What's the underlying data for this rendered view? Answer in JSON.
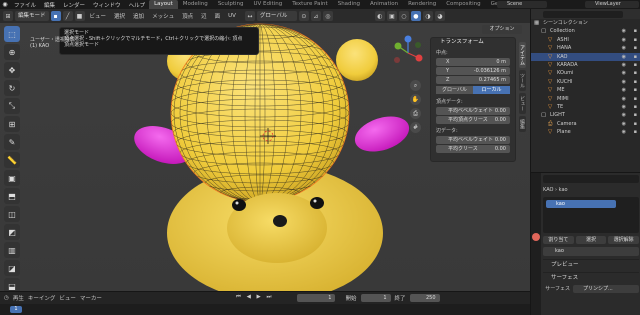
{
  "topbar": {
    "menus": [
      "ファイル",
      "編集",
      "レンダー",
      "ウィンドウ",
      "ヘルプ"
    ],
    "workspaces": [
      "Layout",
      "Modeling",
      "Sculpting",
      "UV Editing",
      "Texture Paint",
      "Shading",
      "Animation",
      "Rendering",
      "Compositing",
      "Geom"
    ],
    "active_workspace": "Layout",
    "scene": "Scene",
    "view_layer": "ViewLayer"
  },
  "viewport_header": {
    "mode": "編集モード",
    "menus": [
      "ビュー",
      "選択",
      "追加",
      "メッシュ",
      "頂点",
      "辺",
      "面",
      "UV"
    ],
    "transform_orientation": "グローバル",
    "options_label": "オプション"
  },
  "tooltip": {
    "line1": "選択モード",
    "line2": "頂点選択 - Shift＋クリックでマルチモード，Ctrl＋クリックで選択の縮小: 頂点",
    "line3": "頂点選択モード"
  },
  "viewport": {
    "view_name": "ユーザー・透視投影",
    "object_info": "(1) KAO"
  },
  "npanel": {
    "title": "トランスフォーム",
    "median_label": "中点:",
    "fields": [
      {
        "axis": "X",
        "value": "0 m"
      },
      {
        "axis": "Y",
        "value": "-0.036126 m"
      },
      {
        "axis": "Z",
        "value": "0.27465 m"
      }
    ],
    "toggle": [
      "グローバル",
      "ローカル"
    ],
    "active_toggle": "ローカル",
    "vertex_data_label": "頂点データ:",
    "vertex_rows": [
      {
        "label": "平均ベベルウェイト",
        "value": "0.00"
      },
      {
        "label": "平均頂点クリース",
        "value": "0.00"
      }
    ],
    "edge_data_label": "辺データ:",
    "edge_rows": [
      {
        "label": "平均ベベルウェイト",
        "value": "0.00"
      },
      {
        "label": "平均クリース",
        "value": "0.00"
      }
    ],
    "side_tabs": [
      "アイテム",
      "ツール",
      "ビュー",
      "編集"
    ]
  },
  "outliner": {
    "rows": [
      {
        "label": "シーンコレクション",
        "icon": "scene-collection-icon",
        "indent": 0,
        "selected": false
      },
      {
        "label": "Collection",
        "icon": "collection-icon",
        "indent": 1,
        "selected": false
      },
      {
        "label": "ASHI",
        "icon": "mesh-icon",
        "indent": 2,
        "selected": false
      },
      {
        "label": "HANA",
        "icon": "mesh-icon",
        "indent": 2,
        "selected": false
      },
      {
        "label": "KAO",
        "icon": "mesh-icon",
        "indent": 2,
        "selected": true
      },
      {
        "label": "KARADA",
        "icon": "mesh-icon",
        "indent": 2,
        "selected": false
      },
      {
        "label": "KOumi",
        "icon": "mesh-icon",
        "indent": 2,
        "selected": false
      },
      {
        "label": "KUCHI",
        "icon": "mesh-icon",
        "indent": 2,
        "selected": false
      },
      {
        "label": "ME",
        "icon": "mesh-icon",
        "indent": 2,
        "selected": false
      },
      {
        "label": "MIMI",
        "icon": "mesh-icon",
        "indent": 2,
        "selected": false
      },
      {
        "label": "TE",
        "icon": "mesh-icon",
        "indent": 2,
        "selected": false
      },
      {
        "label": "LIGHT",
        "icon": "collection-icon",
        "indent": 1,
        "selected": false
      },
      {
        "label": "Camera",
        "icon": "camera-icon",
        "indent": 2,
        "selected": false
      },
      {
        "label": "Plane",
        "icon": "mesh-icon",
        "indent": 2,
        "selected": false
      }
    ]
  },
  "properties": {
    "path": [
      "KAO",
      "kao"
    ],
    "slot": "kao",
    "buttons": [
      "割り当て",
      "選択",
      "選択解除"
    ],
    "material_name": "kao",
    "preview_section": "プレビュー",
    "surface_section": "サーフェス",
    "surface_label": "サーフェス",
    "surface_value": "プリンシプ..."
  },
  "timeline": {
    "menus": [
      "再生",
      "キーイング",
      "ビュー",
      "マーカー"
    ],
    "current_frame": "1",
    "start_label": "開始",
    "start": "1",
    "end_label": "終了",
    "end": "250"
  },
  "colors": {
    "accent": "#4772b3",
    "model_body": "#f4d24a",
    "model_arms": "#e21ad6",
    "selection": "#334d80"
  }
}
